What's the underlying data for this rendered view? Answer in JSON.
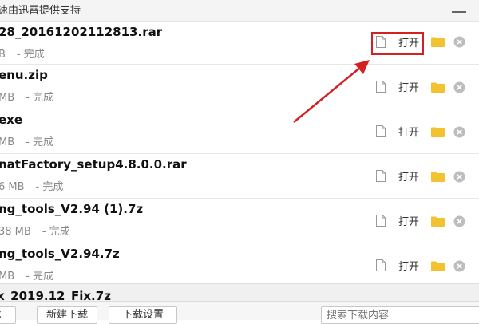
{
  "window": {
    "title": "速由迅雷提供支持"
  },
  "downloads": [
    {
      "name": "28_20161202112813.rar",
      "size": "B",
      "status": "- 完成",
      "open_label": "打开"
    },
    {
      "name": "enu.zip",
      "size": "MB",
      "status": "- 完成",
      "open_label": "打开"
    },
    {
      "name": "exe",
      "size": "MB",
      "status": "- 完成",
      "open_label": "打开"
    },
    {
      "name": "natFactory_setup4.8.0.0.rar",
      "size": "6 MB",
      "status": "- 完成",
      "open_label": "打开"
    },
    {
      "name": "ng_tools_V2.94 (1).7z",
      "size": "38 MB",
      "status": "- 完成",
      "open_label": "打开"
    },
    {
      "name": "ng_tools_V2.94.7z",
      "size": "MB",
      "status": "- 完成",
      "open_label": "打开"
    }
  ],
  "partial_row": {
    "name": "x_2019.12_Fix.7z"
  },
  "toolbar": {
    "left_button": "载",
    "new_download": "新建下载",
    "download_settings": "下载设置",
    "search_placeholder": "搜索下载内容"
  },
  "colors": {
    "highlight_border": "#d42020",
    "folder": "#f2c230",
    "close_circle": "#bdbdbd"
  },
  "icons": {
    "file": "file-icon",
    "folder": "folder-icon",
    "close": "close-icon",
    "minimize": "minimize-icon",
    "arrow": "annotation-arrow"
  }
}
